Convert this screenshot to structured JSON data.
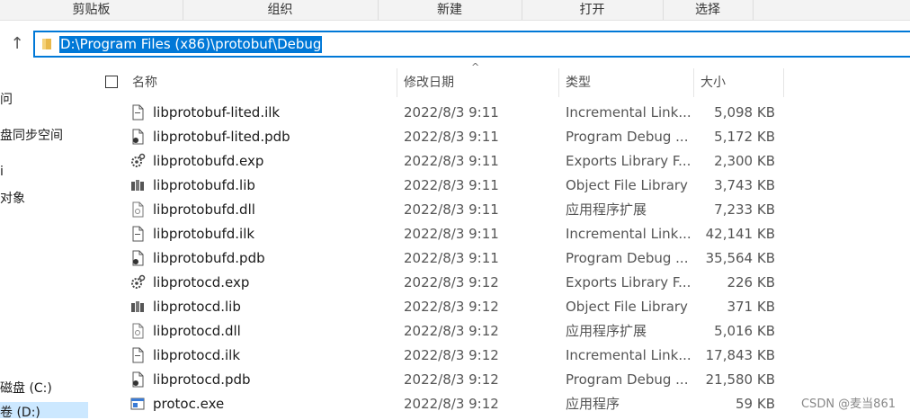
{
  "ribbon": {
    "groups": [
      "剪贴板",
      "组织",
      "新建",
      "打开",
      "选择"
    ]
  },
  "address": {
    "path": "D:\\Program Files (x86)\\protobuf\\Debug"
  },
  "nav": {
    "items": [
      "问",
      "盘同步空间",
      "i",
      "对象",
      "磁盘 (C:)",
      "卷 (D:)"
    ]
  },
  "columns": {
    "name": "名称",
    "date": "修改日期",
    "type": "类型",
    "size": "大小"
  },
  "files": [
    {
      "name": "libprotobuf-lited.ilk",
      "date": "2022/8/3 9:11",
      "type": "Incremental Link...",
      "size": "5,098 KB",
      "icon": "ilk-file-icon"
    },
    {
      "name": "libprotobuf-lited.pdb",
      "date": "2022/8/3 9:11",
      "type": "Program Debug ...",
      "size": "5,172 KB",
      "icon": "pdb-file-icon"
    },
    {
      "name": "libprotobufd.exp",
      "date": "2022/8/3 9:11",
      "type": "Exports Library F...",
      "size": "2,300 KB",
      "icon": "exp-file-icon"
    },
    {
      "name": "libprotobufd.lib",
      "date": "2022/8/3 9:11",
      "type": "Object File Library",
      "size": "3,743 KB",
      "icon": "lib-file-icon"
    },
    {
      "name": "libprotobufd.dll",
      "date": "2022/8/3 9:11",
      "type": "应用程序扩展",
      "size": "7,233 KB",
      "icon": "dll-file-icon"
    },
    {
      "name": "libprotobufd.ilk",
      "date": "2022/8/3 9:11",
      "type": "Incremental Link...",
      "size": "42,141 KB",
      "icon": "ilk-file-icon"
    },
    {
      "name": "libprotobufd.pdb",
      "date": "2022/8/3 9:11",
      "type": "Program Debug ...",
      "size": "35,564 KB",
      "icon": "pdb-file-icon"
    },
    {
      "name": "libprotocd.exp",
      "date": "2022/8/3 9:12",
      "type": "Exports Library F...",
      "size": "226 KB",
      "icon": "exp-file-icon"
    },
    {
      "name": "libprotocd.lib",
      "date": "2022/8/3 9:12",
      "type": "Object File Library",
      "size": "371 KB",
      "icon": "lib-file-icon"
    },
    {
      "name": "libprotocd.dll",
      "date": "2022/8/3 9:12",
      "type": "应用程序扩展",
      "size": "5,016 KB",
      "icon": "dll-file-icon"
    },
    {
      "name": "libprotocd.ilk",
      "date": "2022/8/3 9:12",
      "type": "Incremental Link...",
      "size": "17,843 KB",
      "icon": "ilk-file-icon"
    },
    {
      "name": "libprotocd.pdb",
      "date": "2022/8/3 9:12",
      "type": "Program Debug ...",
      "size": "21,580 KB",
      "icon": "pdb-file-icon"
    },
    {
      "name": "protoc.exe",
      "date": "2022/8/3 9:12",
      "type": "应用程序",
      "size": "59 KB",
      "icon": "exe-file-icon"
    }
  ],
  "watermark": "CSDN @麦当861",
  "colors": {
    "accent": "#0078d7",
    "selection": "#cce8ff"
  }
}
